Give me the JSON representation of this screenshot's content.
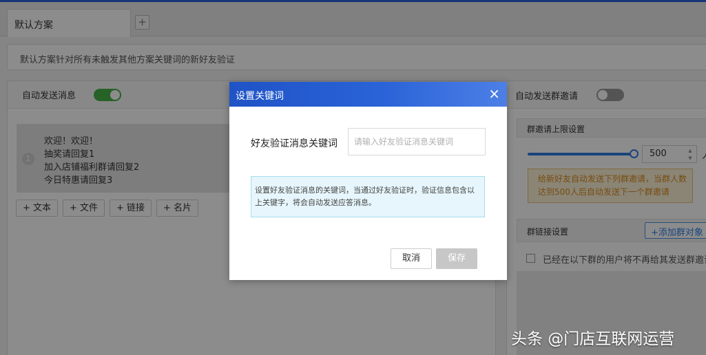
{
  "tabs": {
    "active_label": "默认方案",
    "add_icon": "+"
  },
  "notice": {
    "text": "默认方案针对所有未触发其他方案关键词的新好友验证"
  },
  "left_panel": {
    "auto_send_label": "自动发送消息",
    "auto_send_on": true,
    "message": {
      "index": "1",
      "lines": [
        "欢迎！欢迎！",
        "抽奖请回复1",
        "加入店铺福利群请回复2",
        "今日特惠请回复3"
      ]
    },
    "add_buttons": [
      "+ 文本",
      "+ 文件",
      "+ 链接",
      "+ 名片"
    ]
  },
  "right_panel": {
    "auto_invite_label": "自动发送群邀请",
    "auto_invite_on": false,
    "limit_section_title": "群邀请上限设置",
    "limit_value": "500",
    "limit_unit": "人",
    "slider_fraction": 1.0,
    "warning_text": "给新好友自动发送下列群邀请，当群人数达到500人后自动发送下一个群邀请",
    "group_link_section_title": "群链接设置",
    "add_group_button": "+添加群对象",
    "skip_existing_label": "已经在以下群的用户将不再给其发送群邀请"
  },
  "dialog": {
    "title": "设置关键词",
    "close_icon": "×",
    "field_label": "好友验证消息关键词",
    "field_placeholder": "请输入好友验证消息关键词",
    "field_value": "",
    "tip_text": "设置好友验证消息的关键词，当通过好友验证时，验证信息包含以上关键字，将会自动发送应答消息。",
    "cancel_label": "取消",
    "save_label": "保存"
  },
  "watermark": {
    "text": "头条 @门店互联网运营"
  },
  "colors": {
    "accent": "#2f7de1",
    "dialog_header": "#2a63d8",
    "toggle_on": "#47b347",
    "warning_border": "#e8c173",
    "warning_text": "#d98a1b"
  }
}
